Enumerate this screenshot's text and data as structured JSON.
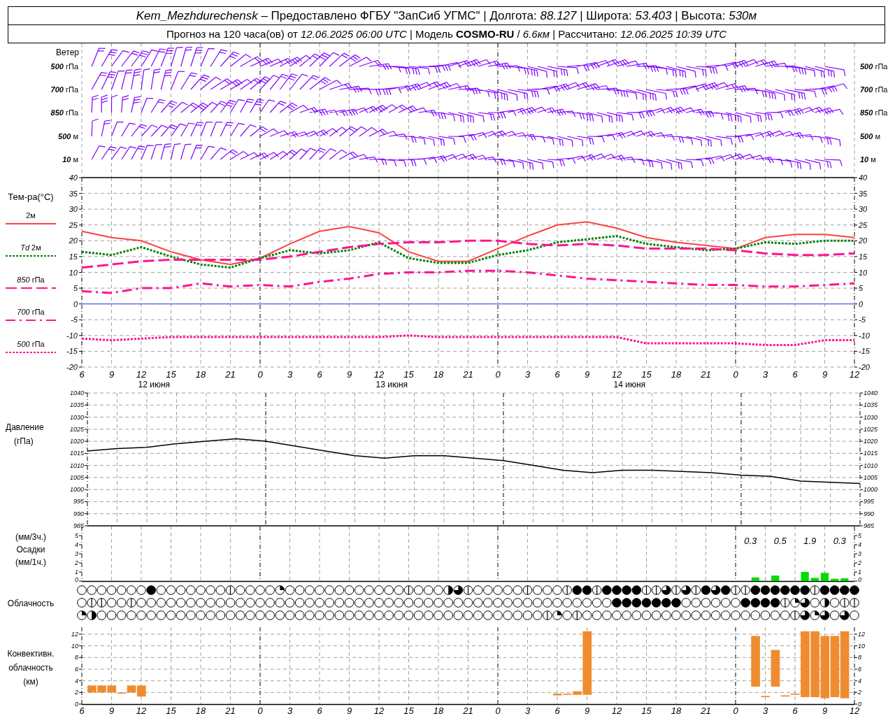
{
  "header": {
    "line1": "*Kem_Mezhdurechensk* – Предоставлено ФГБУ \"ЗапСиб УГМС\" | Долгота: *88.127* | Широта: *53.403* | Высота: *530м*",
    "line2": "Прогноз на 120 часа(ов) от *12.06.2025 06:00 UTC* | Модель **COSMO-RU** / *6.6км* | Рассчитано: *12.06.2025 10:39 UTC*"
  },
  "wind": {
    "title": "Ветер",
    "left_labels": [
      {
        "value": "500",
        "unit": "гПа"
      },
      {
        "value": "700",
        "unit": "гПа"
      },
      {
        "value": "850",
        "unit": "гПа"
      },
      {
        "value": "500",
        "unit": "м"
      },
      {
        "value": "10",
        "unit": "м"
      }
    ],
    "right_labels": [
      {
        "value": "500",
        "unit": "гПа"
      },
      {
        "value": "700",
        "unit": "гПа"
      },
      {
        "value": "850",
        "unit": "гПа"
      },
      {
        "value": "500",
        "unit": "м"
      },
      {
        "value": "10",
        "unit": "м"
      }
    ]
  },
  "temperature": {
    "title": "Тем-ра(°С)",
    "dates": [
      "12 июня",
      "13 июня",
      "14 июня"
    ],
    "legend": [
      "2м",
      "*Td* 2м",
      "*850* гПа",
      "*700* гПа",
      "*500* гПа"
    ],
    "right_ticks": [
      "40",
      "35",
      "30",
      "25",
      "20",
      "15",
      "10",
      "5",
      "0",
      "-5",
      "-10",
      "-15",
      "-20"
    ],
    "chart_data": {
      "type": "line",
      "grid": true,
      "categories": [
        "6",
        "9",
        "12",
        "15",
        "18",
        "21",
        "0",
        "3",
        "6",
        "9",
        "12",
        "15",
        "18",
        "21",
        "0",
        "3",
        "6",
        "9",
        "12",
        "15",
        "18",
        "21",
        "0",
        "3",
        "6",
        "9",
        "12"
      ],
      "series": [
        {
          "color": "#ff4040",
          "line_style": "solid",
          "values": [
            23,
            21,
            20,
            16.5,
            14,
            12.5,
            14.5,
            19,
            23,
            24.5,
            22.5,
            16.5,
            13.5,
            13.5,
            17.5,
            21.5,
            25,
            26,
            24,
            21,
            19.5,
            18.5,
            17.5,
            21,
            22,
            22,
            21
          ]
        },
        {
          "color": "#008000",
          "line_style": "dotted",
          "values": [
            16.5,
            15.5,
            18,
            15,
            12.5,
            11.5,
            14.5,
            17,
            16,
            17,
            19.5,
            14.5,
            13,
            13,
            15.5,
            17,
            19.5,
            20.5,
            21.5,
            19,
            18,
            17,
            17.5,
            19.5,
            19,
            20,
            20
          ]
        },
        {
          "color": "#ff1493",
          "line_style": "dashed",
          "values": [
            11.5,
            12.5,
            13.5,
            14,
            14,
            14,
            14,
            15,
            16.5,
            18,
            19,
            19.5,
            19.5,
            20,
            20,
            19,
            18.5,
            19,
            18.5,
            17.5,
            17.5,
            17.5,
            17,
            16,
            15.5,
            15.5,
            16
          ]
        },
        {
          "color": "#ff1493",
          "line_style": "dashdot",
          "values": [
            4,
            3.5,
            5,
            5,
            6.5,
            5.5,
            6,
            5.5,
            7,
            8,
            9.5,
            10,
            10,
            10.5,
            10.5,
            10,
            9,
            8,
            7.5,
            7,
            6.5,
            6,
            6,
            5.5,
            5.5,
            6,
            6.5
          ]
        },
        {
          "color": "#ff1493",
          "line_style": "dotted",
          "values": [
            -11,
            -11.5,
            -11,
            -10.5,
            -10.5,
            -10.5,
            -10.5,
            -10.5,
            -10.5,
            -10.5,
            -10.5,
            -10,
            -10.5,
            -10.5,
            -10.5,
            -10.5,
            -10.5,
            -10.5,
            -10.5,
            -12.5,
            -12.5,
            -12.5,
            -12.5,
            -13,
            -13,
            -11.5,
            -11.5
          ]
        },
        {
          "color": "#2040ff",
          "line_style": "solid",
          "values": [
            0,
            0,
            0,
            0,
            0,
            0,
            0,
            0,
            0,
            0,
            0,
            0,
            0,
            0,
            0,
            0,
            0,
            0,
            0,
            0,
            0,
            0,
            0,
            0,
            0,
            0,
            0
          ]
        }
      ],
      "ylim": [
        -20,
        40
      ],
      "yticks": [
        -20,
        -15,
        -10,
        -5,
        0,
        5,
        10,
        15,
        20,
        25,
        30,
        35,
        40
      ]
    }
  },
  "pressure": {
    "title": "Давление",
    "unit": "(гПа)",
    "right_ticks": [
      "1040",
      "1035",
      "1030",
      "1025",
      "1020",
      "1015",
      "1010",
      "1005",
      "1000",
      "995",
      "990",
      "985"
    ],
    "chart_data": {
      "type": "line",
      "grid": true,
      "categories": [
        null,
        null,
        null,
        null,
        null,
        null,
        null,
        null,
        null,
        null,
        null,
        null,
        null,
        null,
        null,
        null,
        null,
        null,
        null,
        null,
        null,
        null,
        null,
        null,
        null,
        null,
        null
      ],
      "series": [
        {
          "color": "#000000",
          "values": [
            1016,
            1017,
            1017.5,
            1019,
            1020,
            1021,
            1020,
            1018,
            1016,
            1014,
            1013,
            1014,
            1014,
            1013,
            1012,
            1010,
            1008,
            1007,
            1008,
            1008,
            1007.5,
            1007,
            1006,
            1005.5,
            1003.5,
            1003,
            1002.5
          ]
        }
      ],
      "ylim": [
        985,
        1040
      ],
      "yticks": [
        985,
        990,
        995,
        1000,
        1005,
        1010,
        1015,
        1020,
        1025,
        1030,
        1035,
        1040
      ]
    }
  },
  "precipitation": {
    "labels": [
      "(мм/3ч.)",
      "Осадки",
      "(мм/1ч.)"
    ],
    "totals": [
      "0.3",
      "0.5",
      "1.9",
      "0.3"
    ],
    "right_ticks": [
      "5",
      "4",
      "3",
      "2",
      "1",
      "0"
    ],
    "chart_data": {
      "type": "bar",
      "grid": true,
      "categories": [
        null,
        null,
        null,
        null,
        null,
        null,
        null,
        null,
        null,
        null,
        null,
        null,
        null,
        null,
        null,
        null,
        null,
        null,
        null,
        null,
        null,
        null,
        null,
        null,
        null,
        null,
        null,
        null,
        null,
        null,
        null,
        null,
        null,
        null,
        null,
        null,
        null,
        null,
        null,
        null,
        null,
        null,
        null,
        null,
        null,
        null,
        null,
        null,
        null,
        null,
        null,
        null,
        null,
        null,
        null,
        null,
        null,
        null,
        null,
        null,
        null,
        null,
        null,
        null,
        null,
        null,
        null,
        null,
        null,
        null,
        null,
        null,
        null,
        null,
        null,
        null,
        null,
        null,
        null
      ],
      "series": [
        {
          "color": "#00dd00",
          "values": [
            0,
            0,
            0,
            0,
            0,
            0,
            0,
            0,
            0,
            0,
            0,
            0,
            0,
            0,
            0,
            0,
            0,
            0,
            0,
            0,
            0,
            0,
            0,
            0,
            0,
            0,
            0,
            0,
            0,
            0,
            0,
            0,
            0,
            0,
            0,
            0,
            0,
            0,
            0,
            0,
            0,
            0,
            0,
            0,
            0,
            0,
            0,
            0,
            0,
            0,
            0,
            0,
            0,
            0,
            0,
            0,
            0,
            0,
            0,
            0,
            0,
            0,
            0,
            0,
            0,
            0,
            0,
            0,
            0.4,
            0,
            0.6,
            0,
            0,
            1.0,
            0.35,
            0.9,
            0.25,
            0.3,
            0
          ]
        }
      ],
      "ylim": [
        0,
        6
      ],
      "yticks": [
        0,
        1,
        2,
        3,
        4,
        5
      ]
    }
  },
  "cloudiness": {
    "title": "Облачность",
    "rows": [
      {
        "cells": [
          {
            "kind": "clear"
          },
          {
            "kind": "clear"
          },
          {
            "kind": "clear"
          },
          {
            "kind": "clear"
          },
          {
            "kind": "clear"
          },
          {
            "kind": "clear"
          },
          {
            "kind": "clear"
          },
          {
            "kind": "overcast"
          },
          {
            "kind": "clear"
          },
          {
            "kind": "clear"
          },
          {
            "kind": "clear"
          },
          {
            "kind": "clear"
          },
          {
            "kind": "clear"
          },
          {
            "kind": "clear"
          },
          {
            "kind": "clear"
          },
          {
            "kind": "trace"
          },
          {
            "kind": "clear"
          },
          {
            "kind": "clear"
          },
          {
            "kind": "clear"
          },
          {
            "kind": "clear"
          },
          {
            "kind": "quarter"
          },
          {
            "kind": "clear"
          },
          {
            "kind": "clear"
          },
          {
            "kind": "clear"
          },
          {
            "kind": "clear"
          },
          {
            "kind": "clear"
          },
          {
            "kind": "clear"
          },
          {
            "kind": "clear"
          },
          {
            "kind": "clear"
          },
          {
            "kind": "clear"
          },
          {
            "kind": "clear"
          },
          {
            "kind": "clear"
          },
          {
            "kind": "clear"
          },
          {
            "kind": "trace"
          },
          {
            "kind": "clear"
          },
          {
            "kind": "clear"
          },
          {
            "kind": "clear"
          },
          {
            "kind": "half"
          },
          {
            "kind": "most"
          },
          {
            "kind": "trace"
          },
          {
            "kind": "clear"
          },
          {
            "kind": "clear"
          },
          {
            "kind": "clear"
          },
          {
            "kind": "clear"
          },
          {
            "kind": "clear"
          },
          {
            "kind": "trace"
          },
          {
            "kind": "clear"
          },
          {
            "kind": "clear"
          },
          {
            "kind": "clear"
          },
          {
            "kind": "trace"
          },
          {
            "kind": "overcast"
          },
          {
            "kind": "overcast"
          },
          {
            "kind": "trace"
          },
          {
            "kind": "overcast"
          },
          {
            "kind": "overcast"
          },
          {
            "kind": "overcast"
          },
          {
            "kind": "overcast"
          },
          {
            "kind": "trace"
          },
          {
            "kind": "trace"
          },
          {
            "kind": "most"
          },
          {
            "kind": "trace"
          },
          {
            "kind": "most"
          },
          {
            "kind": "trace"
          },
          {
            "kind": "overcast"
          },
          {
            "kind": "most"
          },
          {
            "kind": "overcast"
          },
          {
            "kind": "trace"
          },
          {
            "kind": "trace"
          },
          {
            "kind": "overcast"
          },
          {
            "kind": "overcast"
          },
          {
            "kind": "overcast"
          },
          {
            "kind": "overcast"
          },
          {
            "kind": "overcast"
          },
          {
            "kind": "overcast"
          },
          {
            "kind": "trace"
          },
          {
            "kind": "overcast"
          },
          {
            "kind": "overcast"
          },
          {
            "kind": "overcast"
          },
          {
            "kind": "overcast"
          }
        ]
      },
      {
        "cells": [
          {
            "kind": "clear"
          },
          {
            "kind": "trace"
          },
          {
            "kind": "trace"
          },
          {
            "kind": "clear"
          },
          {
            "kind": "clear"
          },
          {
            "kind": "trace"
          },
          {
            "kind": "clear"
          },
          {
            "kind": "clear"
          },
          {
            "kind": "clear"
          },
          {
            "kind": "clear"
          },
          {
            "kind": "clear"
          },
          {
            "kind": "clear"
          },
          {
            "kind": "clear"
          },
          {
            "kind": "clear"
          },
          {
            "kind": "clear"
          },
          {
            "kind": "clear"
          },
          {
            "kind": "clear"
          },
          {
            "kind": "clear"
          },
          {
            "kind": "clear"
          },
          {
            "kind": "clear"
          },
          {
            "kind": "clear"
          },
          {
            "kind": "clear"
          },
          {
            "kind": "clear"
          },
          {
            "kind": "clear"
          },
          {
            "kind": "clear"
          },
          {
            "kind": "clear"
          },
          {
            "kind": "clear"
          },
          {
            "kind": "clear"
          },
          {
            "kind": "clear"
          },
          {
            "kind": "clear"
          },
          {
            "kind": "clear"
          },
          {
            "kind": "clear"
          },
          {
            "kind": "clear"
          },
          {
            "kind": "clear"
          },
          {
            "kind": "clear"
          },
          {
            "kind": "clear"
          },
          {
            "kind": "clear"
          },
          {
            "kind": "clear"
          },
          {
            "kind": "clear"
          },
          {
            "kind": "clear"
          },
          {
            "kind": "clear"
          },
          {
            "kind": "clear"
          },
          {
            "kind": "clear"
          },
          {
            "kind": "clear"
          },
          {
            "kind": "clear"
          },
          {
            "kind": "clear"
          },
          {
            "kind": "clear"
          },
          {
            "kind": "clear"
          },
          {
            "kind": "clear"
          },
          {
            "kind": "clear"
          },
          {
            "kind": "clear"
          },
          {
            "kind": "clear"
          },
          {
            "kind": "clear"
          },
          {
            "kind": "clear"
          },
          {
            "kind": "overcast"
          },
          {
            "kind": "overcast"
          },
          {
            "kind": "overcast"
          },
          {
            "kind": "overcast"
          },
          {
            "kind": "overcast"
          },
          {
            "kind": "overcast"
          },
          {
            "kind": "overcast"
          },
          {
            "kind": "clear"
          },
          {
            "kind": "clear"
          },
          {
            "kind": "clear"
          },
          {
            "kind": "clear"
          },
          {
            "kind": "clear"
          },
          {
            "kind": "clear"
          },
          {
            "kind": "overcast"
          },
          {
            "kind": "overcast"
          },
          {
            "kind": "overcast"
          },
          {
            "kind": "overcast"
          },
          {
            "kind": "trace"
          },
          {
            "kind": "quarter"
          },
          {
            "kind": "most"
          },
          {
            "kind": "clear"
          },
          {
            "kind": "half"
          },
          {
            "kind": "clear"
          },
          {
            "kind": "trace"
          },
          {
            "kind": "trace"
          }
        ]
      },
      {
        "cells": [
          {
            "kind": "quarter"
          },
          {
            "kind": "half"
          },
          {
            "kind": "clear"
          },
          {
            "kind": "clear"
          },
          {
            "kind": "clear"
          },
          {
            "kind": "clear"
          },
          {
            "kind": "clear"
          },
          {
            "kind": "clear"
          },
          {
            "kind": "clear"
          },
          {
            "kind": "clear"
          },
          {
            "kind": "clear"
          },
          {
            "kind": "clear"
          },
          {
            "kind": "clear"
          },
          {
            "kind": "clear"
          },
          {
            "kind": "clear"
          },
          {
            "kind": "clear"
          },
          {
            "kind": "clear"
          },
          {
            "kind": "clear"
          },
          {
            "kind": "clear"
          },
          {
            "kind": "clear"
          },
          {
            "kind": "clear"
          },
          {
            "kind": "clear"
          },
          {
            "kind": "clear"
          },
          {
            "kind": "clear"
          },
          {
            "kind": "clear"
          },
          {
            "kind": "clear"
          },
          {
            "kind": "clear"
          },
          {
            "kind": "clear"
          },
          {
            "kind": "clear"
          },
          {
            "kind": "clear"
          },
          {
            "kind": "clear"
          },
          {
            "kind": "clear"
          },
          {
            "kind": "clear"
          },
          {
            "kind": "clear"
          },
          {
            "kind": "clear"
          },
          {
            "kind": "clear"
          },
          {
            "kind": "clear"
          },
          {
            "kind": "clear"
          },
          {
            "kind": "clear"
          },
          {
            "kind": "clear"
          },
          {
            "kind": "clear"
          },
          {
            "kind": "clear"
          },
          {
            "kind": "clear"
          },
          {
            "kind": "clear"
          },
          {
            "kind": "clear"
          },
          {
            "kind": "clear"
          },
          {
            "kind": "clear"
          },
          {
            "kind": "trace"
          },
          {
            "kind": "quarter"
          },
          {
            "kind": "clear"
          },
          {
            "kind": "trace"
          },
          {
            "kind": "clear"
          },
          {
            "kind": "clear"
          },
          {
            "kind": "clear"
          },
          {
            "kind": "clear"
          },
          {
            "kind": "clear"
          },
          {
            "kind": "clear"
          },
          {
            "kind": "clear"
          },
          {
            "kind": "clear"
          },
          {
            "kind": "clear"
          },
          {
            "kind": "clear"
          },
          {
            "kind": "clear"
          },
          {
            "kind": "clear"
          },
          {
            "kind": "clear"
          },
          {
            "kind": "clear"
          },
          {
            "kind": "clear"
          },
          {
            "kind": "clear"
          },
          {
            "kind": "clear"
          },
          {
            "kind": "clear"
          },
          {
            "kind": "clear"
          },
          {
            "kind": "clear"
          },
          {
            "kind": "clear"
          },
          {
            "kind": "trace"
          },
          {
            "kind": "most"
          },
          {
            "kind": "quarter"
          },
          {
            "kind": "most"
          },
          {
            "kind": "clear"
          },
          {
            "kind": "most"
          },
          {
            "kind": "clear"
          }
        ]
      }
    ]
  },
  "convective": {
    "labels": [
      "Конвективн.",
      "облачность",
      "(км)"
    ],
    "right_ticks": [
      "12",
      "10",
      "8",
      "6",
      "4",
      "2",
      "0"
    ],
    "chart_data": {
      "type": "candlestick",
      "grid": true,
      "categories": [
        "6",
        null,
        null,
        "9",
        null,
        null,
        "12",
        null,
        null,
        "15",
        null,
        null,
        "18",
        null,
        null,
        "21",
        null,
        null,
        "0",
        null,
        null,
        "3",
        null,
        null,
        "6",
        null,
        null,
        "9",
        null,
        null,
        "12",
        null,
        null,
        "15",
        null,
        null,
        "18",
        null,
        null,
        "21",
        null,
        null,
        "0",
        null,
        null,
        "3",
        null,
        null,
        "6",
        null,
        null,
        "9",
        null,
        null,
        "12",
        null,
        null,
        "15",
        null,
        null,
        "18",
        null,
        null,
        "21",
        null,
        null,
        "0",
        null,
        null,
        "3",
        null,
        null,
        "6",
        null,
        null,
        "9",
        null,
        null,
        "12"
      ],
      "series": [
        {
          "color": "#f08c30",
          "ohlc": [
            null,
            [
              2,
              3.2,
              2,
              3.2
            ],
            [
              2,
              3.2,
              2,
              3.2
            ],
            [
              2,
              3.2,
              2,
              3.2
            ],
            [
              1.8,
              2,
              1.8,
              2
            ],
            [
              2,
              3.2,
              2,
              3.2
            ],
            [
              1.3,
              3.2,
              1.3,
              3.2
            ],
            null,
            null,
            null,
            null,
            null,
            null,
            null,
            null,
            null,
            null,
            null,
            null,
            null,
            null,
            null,
            null,
            null,
            null,
            null,
            null,
            null,
            null,
            null,
            null,
            null,
            null,
            null,
            null,
            null,
            null,
            null,
            null,
            null,
            null,
            null,
            null,
            null,
            null,
            null,
            null,
            null,
            [
              1.5,
              1.8,
              1.5,
              1.8
            ],
            [
              1.6,
              1.8,
              1.6,
              1.8
            ],
            [
              1.6,
              2.2,
              1.6,
              2.2
            ],
            [
              1.6,
              12.5,
              1.6,
              12.5
            ],
            null,
            null,
            null,
            null,
            null,
            null,
            null,
            null,
            null,
            null,
            null,
            null,
            null,
            null,
            null,
            null,
            [
              3,
              11.7,
              3,
              11.7
            ],
            [
              1.2,
              1.4,
              1.2,
              1.4
            ],
            [
              3,
              9.3,
              3,
              9.3
            ],
            [
              1.3,
              1.5,
              1.3,
              1.5
            ],
            [
              1.6,
              1.8,
              1.6,
              1.8
            ],
            [
              1.2,
              12.5,
              1.2,
              12.5
            ],
            [
              1.2,
              12.5,
              1.2,
              12.5
            ],
            [
              1,
              11.7,
              1,
              11.7
            ],
            [
              1.2,
              11.7,
              1.2,
              11.7
            ],
            [
              1,
              12.5,
              1,
              12.5
            ],
            null
          ]
        }
      ],
      "ylim": [
        0,
        13.5
      ],
      "yticks": [
        0,
        2,
        4,
        6,
        8,
        10,
        12
      ]
    }
  }
}
